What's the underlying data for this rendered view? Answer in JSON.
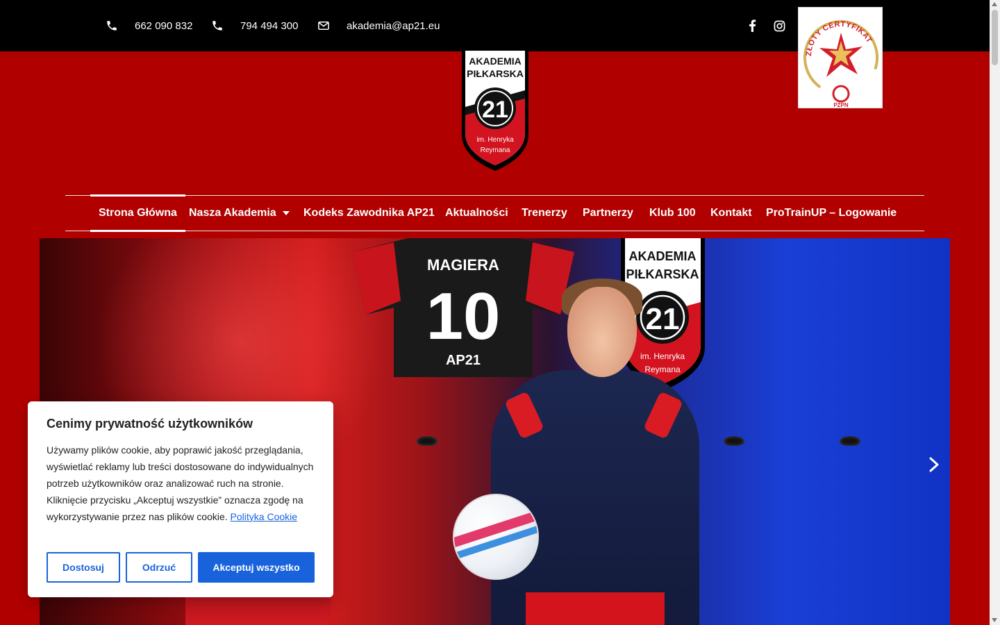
{
  "topbar": {
    "phone1": "662 090 832",
    "phone2": "794 494 300",
    "email": "akademia@ap21.eu",
    "icons": [
      "phone-icon",
      "phone-icon",
      "envelope-icon",
      "facebook-icon",
      "instagram-icon"
    ]
  },
  "certificate": {
    "title": "ZŁOTY CERTYFIKAT",
    "org": "PZPN"
  },
  "crest": {
    "line1": "AKADEMIA",
    "line2": "PIŁKARSKA",
    "number": "21",
    "line3": "im. Henryka",
    "line4": "Reymana"
  },
  "nav": {
    "items": [
      {
        "label": "Strona Główna"
      },
      {
        "label": "Nasza Akademia"
      },
      {
        "label": "Kodeks Zawodnika AP21"
      },
      {
        "label": "Aktualności"
      },
      {
        "label": "Trenerzy"
      },
      {
        "label": "Partnerzy"
      },
      {
        "label": "Klub 100"
      },
      {
        "label": "Kontakt"
      },
      {
        "label": "ProTrainUP – Logowanie"
      }
    ]
  },
  "hero": {
    "jersey_name": "MAGIERA",
    "jersey_number": "10",
    "jersey_sub": "AP21"
  },
  "cookie": {
    "title": "Cenimy prywatność użytkowników",
    "text": "Używamy plików cookie, aby poprawić jakość przeglądania, wyświetlać reklamy lub treści dostosowane do indywidualnych potrzeb użytkowników oraz analizować ruch na stronie. Kliknięcie przycisku „Akceptuj wszystkie” oznacza zgodę na wykorzystywanie przez nas plików cookie.",
    "link": "Polityka Cookie",
    "btn_customize": "Dostosuj",
    "btn_reject": "Odrzuć",
    "btn_accept": "Akceptuj wszystko"
  },
  "colors": {
    "brand_red": "#b10000",
    "topbar": "#000000",
    "cookie_blue": "#1863dc"
  }
}
